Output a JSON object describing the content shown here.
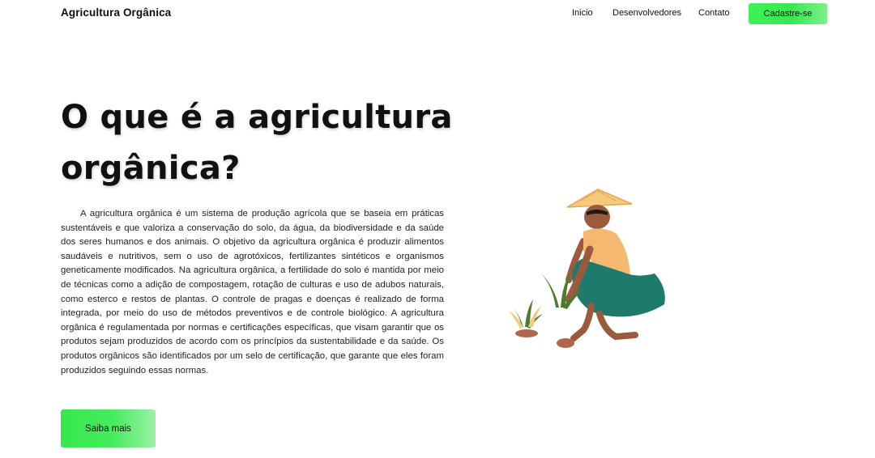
{
  "header": {
    "brand": "Agricultura Orgânica",
    "nav": [
      "Inicio",
      "Desenvolvedores",
      "Contato"
    ],
    "signup_label": "Cadastre-se"
  },
  "hero": {
    "title": "O que é a agricultura orgânica?",
    "paragraph": "A agricultura orgânica é um sistema de produção agrícola que se baseia em práticas sustentáveis e que valoriza a conservação do solo, da água, da biodiversidade e da saúde dos seres humanos e dos animais. O objetivo da agricultura orgânica é produzir alimentos saudáveis e nutritivos, sem o uso de agrotóxicos, fertilizantes sintéticos e organismos geneticamente modificados. Na agricultura orgânica, a fertilidade do solo é mantida por meio de técnicas como a adição de compostagem, rotação de culturas e uso de adubos naturais, como esterco e restos de plantas. O controle de pragas e doenças é realizado de forma integrada, por meio do uso de métodos preventivos e de controle biológico. A agricultura orgânica é regulamentada por normas e certificações específicas, que visam garantir que os produtos sejam produzidos de acordo com os princípios da sustentabilidade e da saúde. Os produtos orgânicos são identificados por um selo de certificação, que garante que eles foram produzidos seguindo essas normas.",
    "cta_label": "Saiba mais"
  },
  "colors": {
    "accent_green": "#3ff05a",
    "hat": "#f6c97c",
    "shirt": "#f5b870",
    "pants": "#1f7a6e",
    "skin": "#9c5a3c",
    "plant": "#4c7a2e"
  },
  "illustration": {
    "icon": "farmer-planting-icon"
  }
}
